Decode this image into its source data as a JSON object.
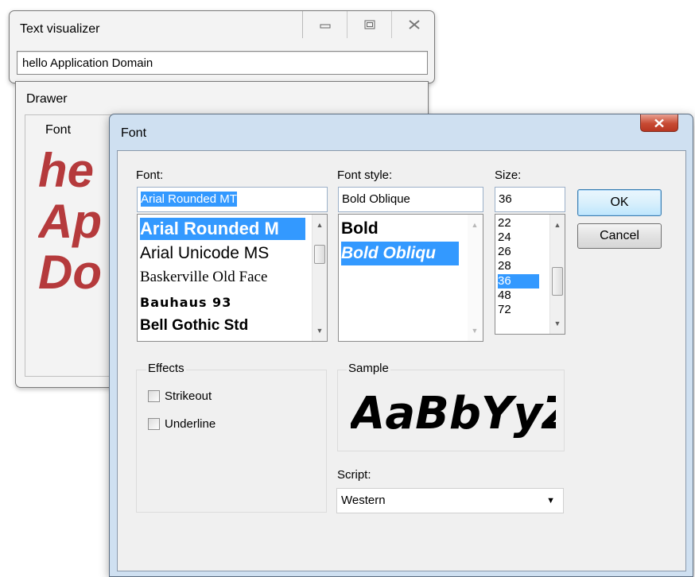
{
  "text_visualizer": {
    "title": "Text visualizer",
    "input_value": "hello Application Domain"
  },
  "drawer": {
    "title": "Drawer",
    "group_label": "Font",
    "sample_lines": [
      "he",
      "Ap",
      "Do"
    ],
    "sample_color": "#b53a3c"
  },
  "font_dialog": {
    "title": "Font",
    "font_label": "Font:",
    "font_value": "Arial Rounded MT",
    "font_list": [
      "Arial Rounded M",
      "Arial Unicode MS",
      "Baskerville Old Face",
      "Bauhaus 93",
      "Bell Gothic Std"
    ],
    "style_label": "Font style:",
    "style_value": "Bold Oblique",
    "style_list": [
      "Bold",
      "Bold Obliqu"
    ],
    "size_label": "Size:",
    "size_value": "36",
    "size_list": [
      "22",
      "24",
      "26",
      "28",
      "36",
      "48",
      "72"
    ],
    "ok_label": "OK",
    "cancel_label": "Cancel",
    "effects_label": "Effects",
    "strikeout_label": "Strikeout",
    "underline_label": "Underline",
    "sample_label": "Sample",
    "sample_text": "AaBbYyZz",
    "script_label": "Script:",
    "script_value": "Western"
  },
  "icons": {
    "minimize": "minimize-icon",
    "maximize": "maximize-icon",
    "close": "close-icon",
    "dropdown": "chevron-down-icon"
  },
  "colors": {
    "selection": "#3399ff",
    "dialog_frame": "#cfe0f1",
    "close_button": "#c74a33"
  }
}
